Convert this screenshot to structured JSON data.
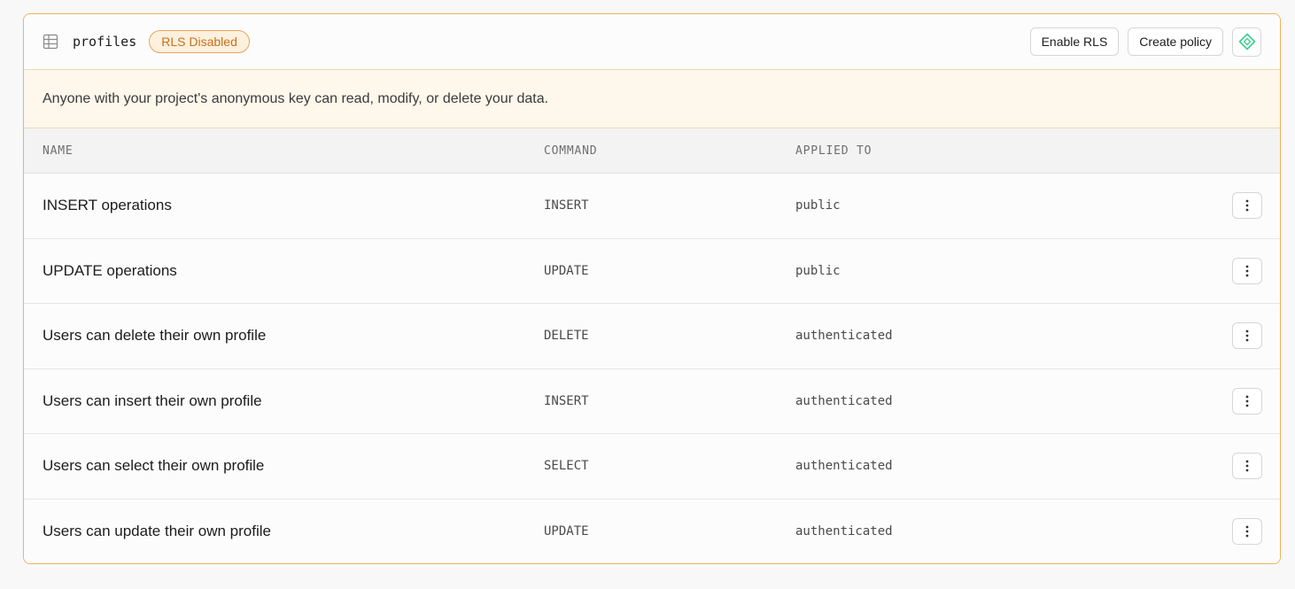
{
  "header": {
    "table_icon": "table-grid-icon",
    "table_name": "profiles",
    "status_badge": "RLS Disabled",
    "enable_rls_label": "Enable RLS",
    "create_policy_label": "Create policy",
    "extra_icon": "diamond-icon"
  },
  "warning": {
    "text": "Anyone with your project's anonymous key can read, modify, or delete your data."
  },
  "columns": {
    "name": "NAME",
    "command": "COMMAND",
    "applied_to": "APPLIED TO"
  },
  "policies": [
    {
      "name": "INSERT operations",
      "command": "INSERT",
      "applied_to": "public"
    },
    {
      "name": "UPDATE operations",
      "command": "UPDATE",
      "applied_to": "public"
    },
    {
      "name": "Users can delete their own profile",
      "command": "DELETE",
      "applied_to": "authenticated"
    },
    {
      "name": "Users can insert their own profile",
      "command": "INSERT",
      "applied_to": "authenticated"
    },
    {
      "name": "Users can select their own profile",
      "command": "SELECT",
      "applied_to": "authenticated"
    },
    {
      "name": "Users can update their own profile",
      "command": "UPDATE",
      "applied_to": "authenticated"
    }
  ],
  "colors": {
    "accent_border": "#f0b35c",
    "badge_text": "#c8701d",
    "badge_bg": "#fdf0dd",
    "warning_bg": "#fdf7ec",
    "brand_green": "#3ecf8e"
  }
}
